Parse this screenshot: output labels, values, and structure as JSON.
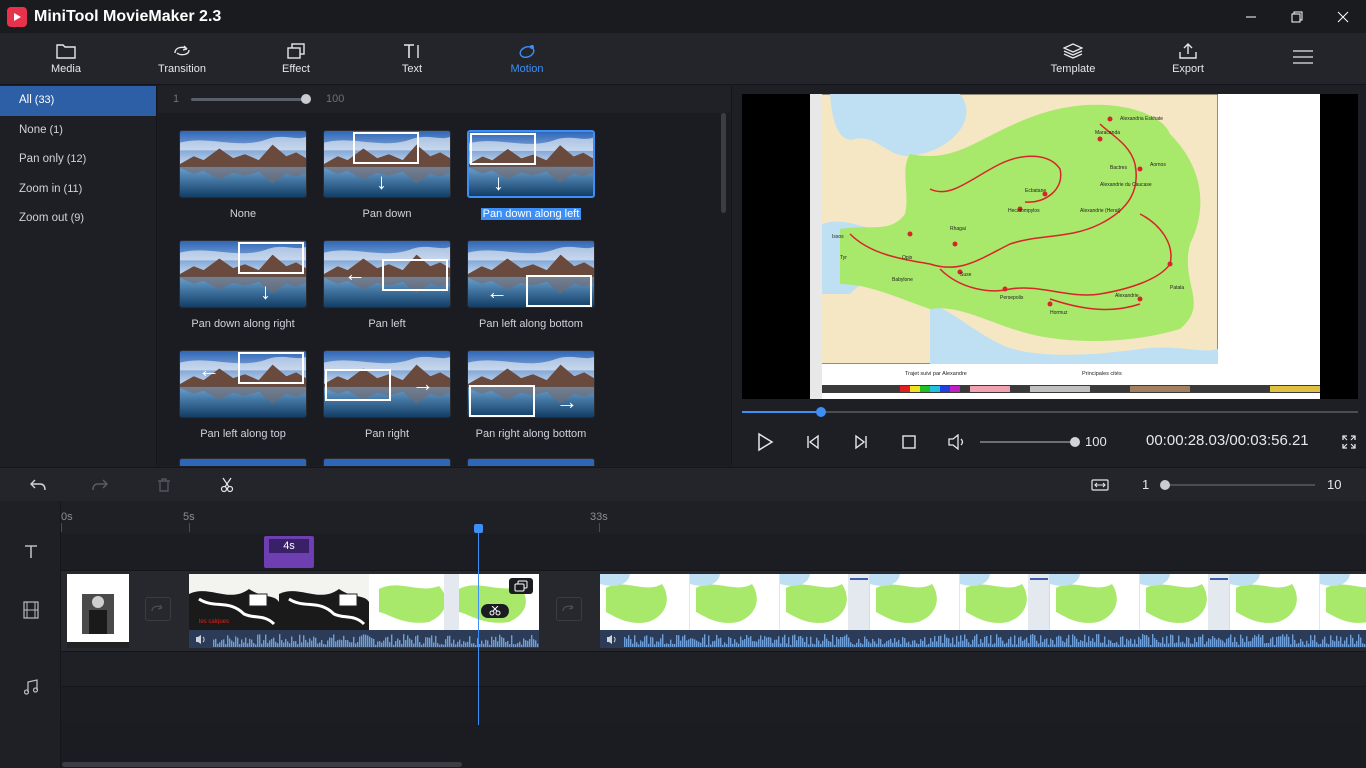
{
  "window": {
    "title": "MiniTool MovieMaker 2.3"
  },
  "toolbar": {
    "media": "Media",
    "transition": "Transition",
    "effect": "Effect",
    "text": "Text",
    "motion": "Motion",
    "template": "Template",
    "export": "Export"
  },
  "categories": [
    {
      "label": "All",
      "count": "(33)"
    },
    {
      "label": "None",
      "count": "(1)"
    },
    {
      "label": "Pan only",
      "count": "(12)"
    },
    {
      "label": "Zoom in",
      "count": "(11)"
    },
    {
      "label": "Zoom out",
      "count": "(9)"
    }
  ],
  "duration": {
    "min": "1",
    "max": "100",
    "level": 1.0
  },
  "motions": [
    {
      "label": "None",
      "selected": false
    },
    {
      "label": "Pan down",
      "selected": false
    },
    {
      "label": "Pan down along left",
      "selected": true
    },
    {
      "label": "Pan down along right",
      "selected": false
    },
    {
      "label": "Pan left",
      "selected": false
    },
    {
      "label": "Pan left along bottom",
      "selected": false
    },
    {
      "label": "Pan left along top",
      "selected": false
    },
    {
      "label": "Pan right",
      "selected": false
    },
    {
      "label": "Pan right along bottom",
      "selected": false
    }
  ],
  "player": {
    "progress": 0.128,
    "volume_level": 1.0,
    "volume": "100",
    "timecode": "00:00:28.03/00:03:56.21"
  },
  "map": {
    "labels": [
      "Alexandria Eskhate",
      "Maracanda",
      "Aornos",
      "Bactres",
      "Alexandrie du Caucase",
      "Ecbatane",
      "Alexandrie (Herat)",
      "Hecatompylos",
      "Rhagai",
      "Suse",
      "Babylone",
      "Opis",
      "Persepolis",
      "Alexandrie",
      "Hormuz",
      "Patala",
      "Tyr",
      "Issos"
    ],
    "legend1": "Trajet suivi par Alexandre",
    "legend2": "Principales cités"
  },
  "timeline_zoom": {
    "min": "1",
    "max": "10",
    "level": 0.0
  },
  "ruler": [
    {
      "label": "0s"
    },
    {
      "label": "5s"
    },
    {
      "label": "33s"
    }
  ],
  "text_clip": {
    "label": "4s"
  },
  "clip_caption": "les calques",
  "colors": {
    "accent": "#3d8ff5",
    "selected_category": "#2d5fa6",
    "text_clip": "#6e3fb3",
    "map_land": "#a8e86a",
    "map_sea": "#bfe0f2",
    "map_route": "#d8242a"
  }
}
